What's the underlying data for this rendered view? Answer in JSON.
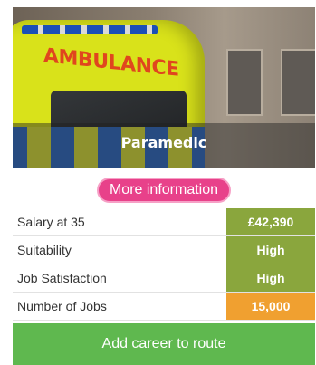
{
  "hero": {
    "title": "Paramedic",
    "vehicle_text": "AMBULANCE"
  },
  "more_info_label": "More information",
  "stats": [
    {
      "label": "Salary at 35",
      "value": "£42,390",
      "color": "#8aa63d"
    },
    {
      "label": "Suitability",
      "value": "High",
      "color": "#8aa63d"
    },
    {
      "label": "Job Satisfaction",
      "value": "High",
      "color": "#8aa63d"
    },
    {
      "label": "Number of Jobs",
      "value": "15,000",
      "color": "#f0a030"
    }
  ],
  "add_route_label": "Add career to route",
  "colors": {
    "accent_pink": "#e8418a",
    "accent_green": "#5fb84f",
    "value_green": "#8aa63d",
    "value_orange": "#f0a030"
  }
}
